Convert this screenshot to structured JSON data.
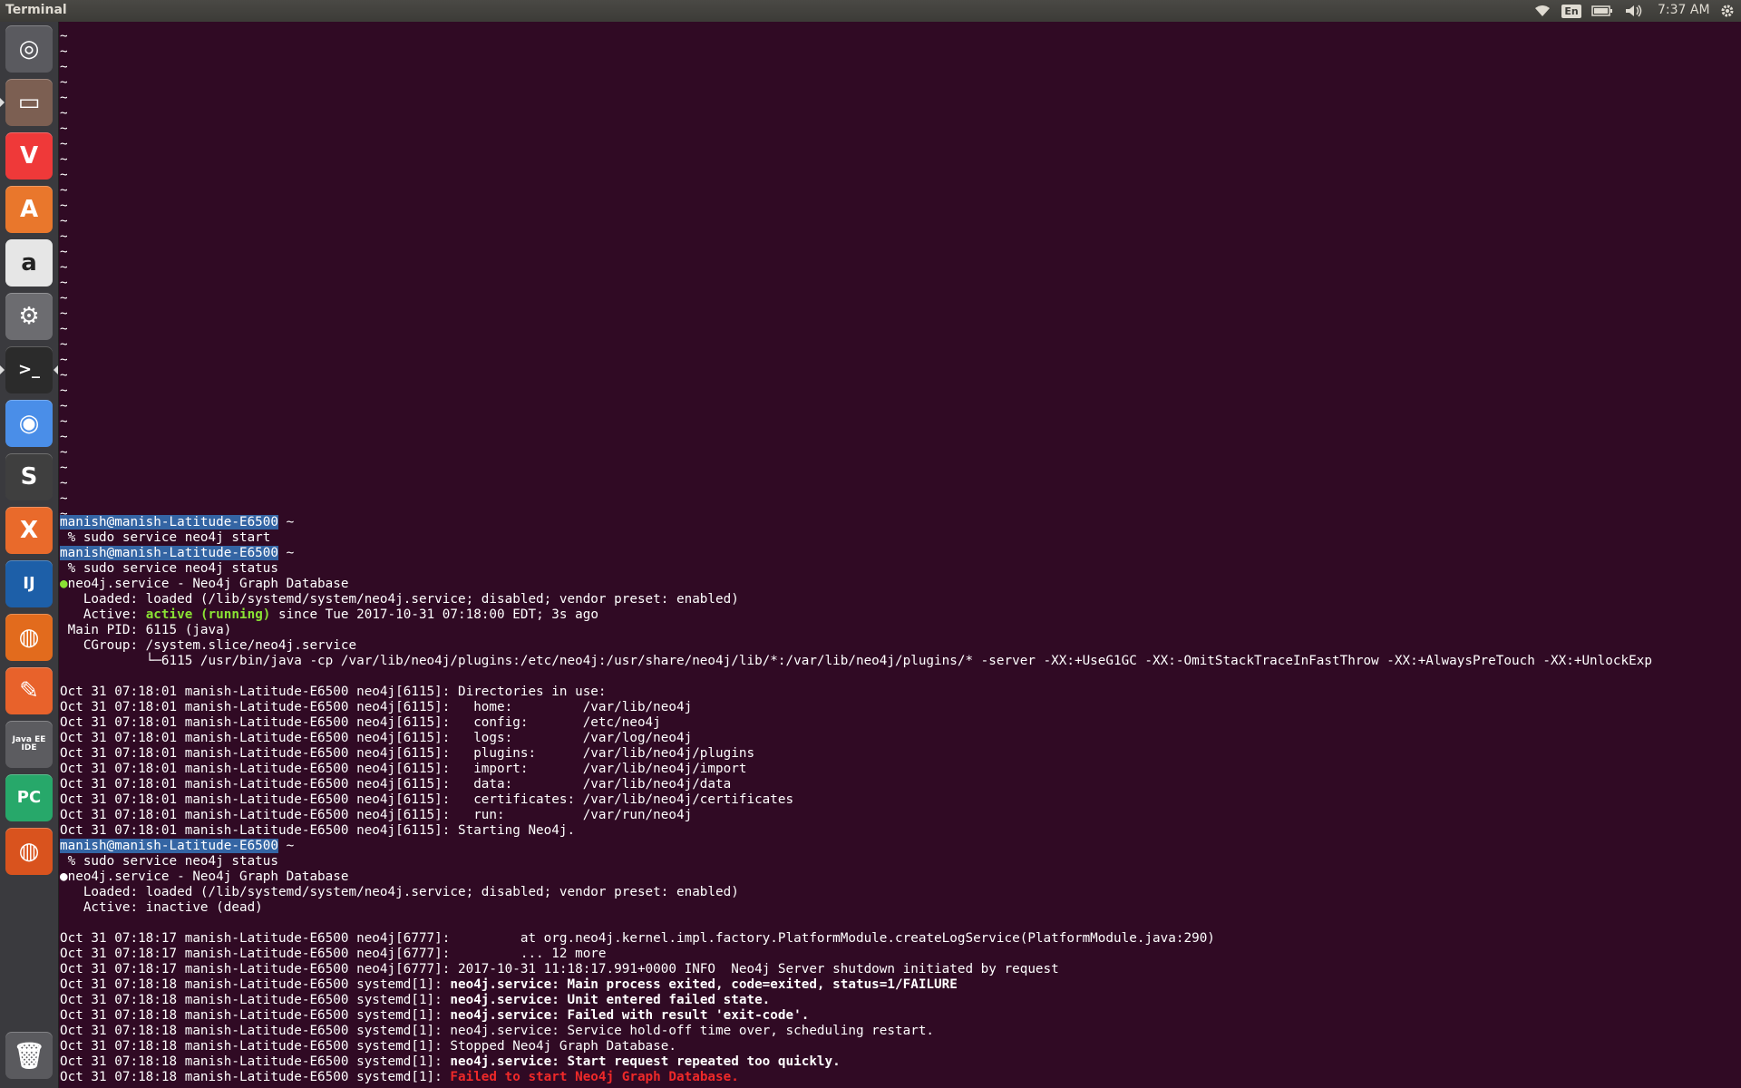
{
  "topbar": {
    "app_title": "Terminal",
    "keyboard_layout": "En",
    "clock": "7:37 AM",
    "icons": [
      "wifi-icon",
      "keyboard-layout-indicator",
      "battery-icon",
      "volume-icon",
      "settings-gear-icon"
    ]
  },
  "launcher": {
    "items": [
      {
        "name": "ubuntu-dash",
        "glyph": "◎",
        "bg": "#5a5a5f"
      },
      {
        "name": "files",
        "glyph": "▭",
        "bg": "#7c5f52"
      },
      {
        "name": "vivaldi",
        "glyph": "V",
        "bg": "#ef3939"
      },
      {
        "name": "ubuntu-software",
        "glyph": "A",
        "bg": "#e9772c"
      },
      {
        "name": "amazon",
        "glyph": "a",
        "bg": "#e6e6e6"
      },
      {
        "name": "system-settings",
        "glyph": "⚙",
        "bg": "#6c6c70"
      },
      {
        "name": "terminal",
        "glyph": ">_",
        "bg": "#2b2b2b"
      },
      {
        "name": "chrome",
        "glyph": "◉",
        "bg": "#4a8ee8"
      },
      {
        "name": "sublime-text",
        "glyph": "S",
        "bg": "#3f3f3f"
      },
      {
        "name": "xampp",
        "glyph": "X",
        "bg": "#e96a2b"
      },
      {
        "name": "intellij-idea",
        "glyph": "IJ",
        "bg": "#1d5fa8"
      },
      {
        "name": "firefox",
        "glyph": "◍",
        "bg": "#e26b1d"
      },
      {
        "name": "postman",
        "glyph": "✎",
        "bg": "#e8622b"
      },
      {
        "name": "java-ee-ide",
        "glyph": "Java EE IDE",
        "bg": "#5c5c60"
      },
      {
        "name": "pycharm",
        "glyph": "PC",
        "bg": "#27a86a"
      },
      {
        "name": "firefox-2",
        "glyph": "◍",
        "bg": "#d9531e"
      }
    ],
    "trash": {
      "name": "trash",
      "glyph": "🗑"
    }
  },
  "terminal": {
    "tilde": "~",
    "tilde_count": 32,
    "prompt_user": "manish@manish-Latitude-E6500",
    "prompt_suffix": " ~",
    "lines": {
      "cmd1": " % sudo service neo4j start",
      "cmd2": " % sudo service neo4j status",
      "s1_head": "neo4j.service - Neo4j Graph Database",
      "s1_loaded": "   Loaded: loaded (/lib/systemd/system/neo4j.service; disabled; vendor preset: enabled)",
      "s1_active_pre": "   Active: ",
      "s1_active_state": "active (running)",
      "s1_active_post": " since Tue 2017-10-31 07:18:00 EDT; 3s ago",
      "s1_pid": " Main PID: 6115 (java)",
      "s1_cgroup": "   CGroup: /system.slice/neo4j.service",
      "s1_proc": "           └─6115 /usr/bin/java -cp /var/lib/neo4j/plugins:/etc/neo4j:/usr/share/neo4j/lib/*:/var/lib/neo4j/plugins/* -server -XX:+UseG1GC -XX:-OmitStackTraceInFastThrow -XX:+AlwaysPreTouch -XX:+UnlockExp",
      "log1": "Oct 31 07:18:01 manish-Latitude-E6500 neo4j[6115]: Directories in use:",
      "log2": "Oct 31 07:18:01 manish-Latitude-E6500 neo4j[6115]:   home:         /var/lib/neo4j",
      "log3": "Oct 31 07:18:01 manish-Latitude-E6500 neo4j[6115]:   config:       /etc/neo4j",
      "log4": "Oct 31 07:18:01 manish-Latitude-E6500 neo4j[6115]:   logs:         /var/log/neo4j",
      "log5": "Oct 31 07:18:01 manish-Latitude-E6500 neo4j[6115]:   plugins:      /var/lib/neo4j/plugins",
      "log6": "Oct 31 07:18:01 manish-Latitude-E6500 neo4j[6115]:   import:       /var/lib/neo4j/import",
      "log7": "Oct 31 07:18:01 manish-Latitude-E6500 neo4j[6115]:   data:         /var/lib/neo4j/data",
      "log8": "Oct 31 07:18:01 manish-Latitude-E6500 neo4j[6115]:   certificates: /var/lib/neo4j/certificates",
      "log9": "Oct 31 07:18:01 manish-Latitude-E6500 neo4j[6115]:   run:          /var/run/neo4j",
      "log10": "Oct 31 07:18:01 manish-Latitude-E6500 neo4j[6115]: Starting Neo4j.",
      "s2_head": "neo4j.service - Neo4j Graph Database",
      "s2_loaded": "   Loaded: loaded (/lib/systemd/system/neo4j.service; disabled; vendor preset: enabled)",
      "s2_active": "   Active: inactive (dead)",
      "e1": "Oct 31 07:18:17 manish-Latitude-E6500 neo4j[6777]:         at org.neo4j.kernel.impl.factory.PlatformModule.createLogService(PlatformModule.java:290)",
      "e2": "Oct 31 07:18:17 manish-Latitude-E6500 neo4j[6777]:         ... 12 more",
      "e3": "Oct 31 07:18:17 manish-Latitude-E6500 neo4j[6777]: 2017-10-31 11:18:17.991+0000 INFO  Neo4j Server shutdown initiated by request",
      "e4_pre": "Oct 31 07:18:18 manish-Latitude-E6500 systemd[1]: ",
      "e4_bold": "neo4j.service: Main process exited, code=exited, status=1/FAILURE",
      "e5_pre": "Oct 31 07:18:18 manish-Latitude-E6500 systemd[1]: ",
      "e5_bold": "neo4j.service: Unit entered failed state.",
      "e6_pre": "Oct 31 07:18:18 manish-Latitude-E6500 systemd[1]: ",
      "e6_bold": "neo4j.service: Failed with result 'exit-code'.",
      "e7": "Oct 31 07:18:18 manish-Latitude-E6500 systemd[1]: neo4j.service: Service hold-off time over, scheduling restart.",
      "e8": "Oct 31 07:18:18 manish-Latitude-E6500 systemd[1]: Stopped Neo4j Graph Database.",
      "e9_pre": "Oct 31 07:18:18 manish-Latitude-E6500 systemd[1]: ",
      "e9_bold": "neo4j.service: Start request repeated too quickly.",
      "e10_pre": "Oct 31 07:18:18 manish-Latitude-E6500 systemd[1]: ",
      "e10_red": "Failed to start Neo4j Graph Database."
    }
  },
  "colors": {
    "terminal_bg": "#300a24",
    "prompt_highlight": "#3465a4",
    "active_green": "#8ae234",
    "error_red": "#ef2929"
  }
}
